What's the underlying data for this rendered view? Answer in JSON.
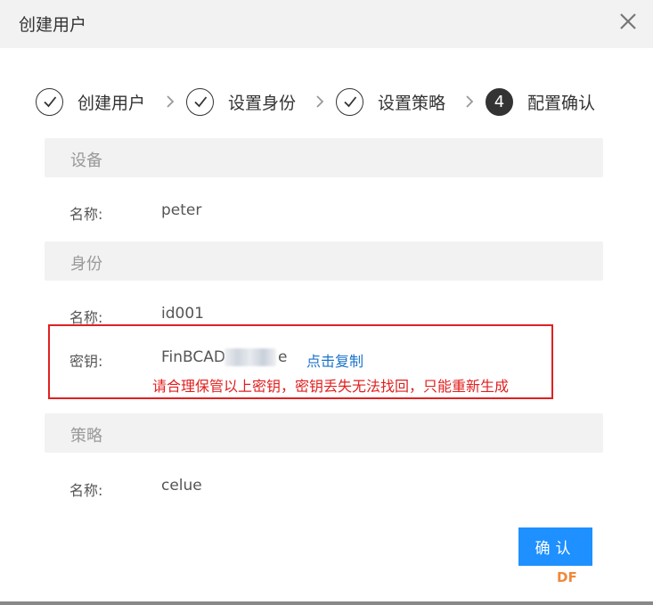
{
  "dialog": {
    "title": "创建用户"
  },
  "steps": [
    {
      "label": "创建用户",
      "state": "done"
    },
    {
      "label": "设置身份",
      "state": "done"
    },
    {
      "label": "设置策略",
      "state": "done"
    },
    {
      "label": "配置确认",
      "state": "active",
      "number": "4"
    }
  ],
  "device": {
    "section_title": "设备",
    "name_label": "名称:",
    "name_value": "peter"
  },
  "identity": {
    "section_title": "身份",
    "name_label": "名称:",
    "name_value": "id001",
    "key_label": "密钥:",
    "key_value": "FinBCAD",
    "key_tail": "e",
    "copy_link": "点击复制",
    "warning": "请合理保管以上密钥，密钥丢失无法找回，只能重新生成"
  },
  "policy": {
    "section_title": "策略",
    "name_label": "名称:",
    "name_value": "celue"
  },
  "footer": {
    "confirm_label": "确认",
    "watermark": "DF"
  },
  "colors": {
    "primary": "#1e90ff",
    "warning": "#e02020",
    "section_bg": "#f2f2f2",
    "link": "#1a73c9"
  },
  "icons": {
    "close": "close-icon",
    "check": "check-icon",
    "chevron": "chevron-right-icon"
  }
}
